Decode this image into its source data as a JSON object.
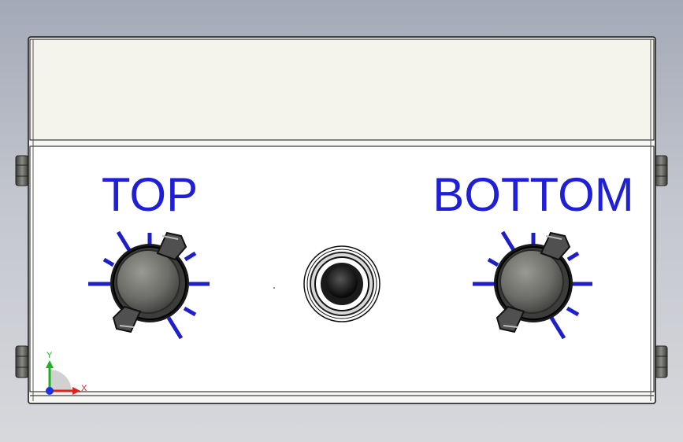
{
  "labels": {
    "left_knob": "TOP",
    "right_knob": "BOTTOM"
  },
  "axis_triad": {
    "x_label": "X",
    "y_label": "Y"
  },
  "colors": {
    "background_top": "#a3a9b7",
    "background_bottom": "#d6d8dc",
    "panel_top": "#f5f4ec",
    "panel_face": "#ffffff",
    "label_text": "#1f1fd6",
    "tick_marks": "#1f1fc8",
    "knob_body": "#6a6a66",
    "jack_core": "#111111",
    "axis_x": "#e02020",
    "axis_y": "#20b020",
    "axis_z": "#2030e0"
  },
  "icons": {
    "left_knob": "rotary-knob-icon",
    "right_knob": "rotary-knob-icon",
    "jack": "audio-jack-icon",
    "triad": "coordinate-triad-icon"
  }
}
